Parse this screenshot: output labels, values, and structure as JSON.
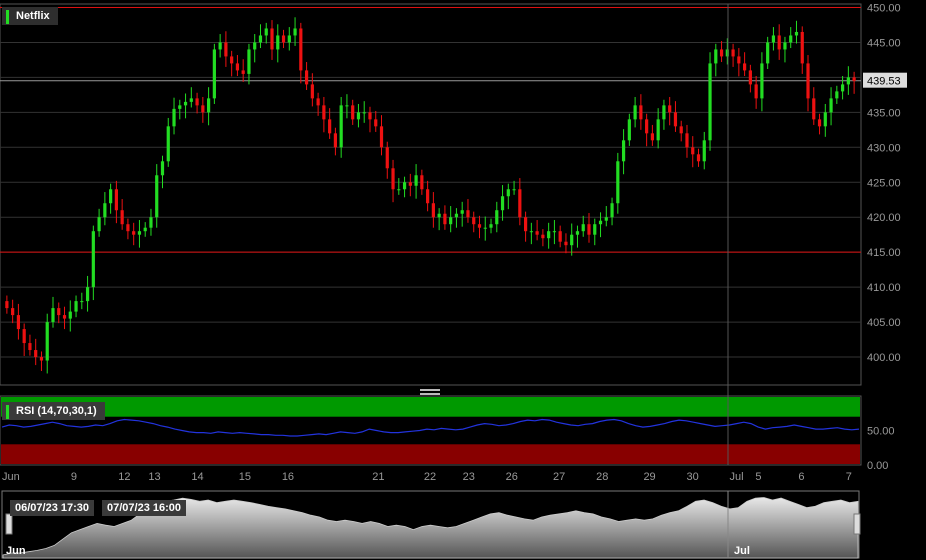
{
  "window": {
    "symbol": "Netflix"
  },
  "colors": {
    "up": "#22dd22",
    "down": "#ee1111",
    "rsi_line": "#2233dd",
    "upper_band": "#009900",
    "lower_band": "#880000",
    "hline": "#dd1111"
  },
  "chart_data": [
    {
      "type": "candlestick",
      "title": "Netflix",
      "ylim": [
        396,
        450.5
      ],
      "y_ticks": [
        "450.00",
        "445.00",
        "440.00",
        "435.00",
        "430.00",
        "425.00",
        "420.00",
        "415.00",
        "410.00",
        "405.00",
        "400.00"
      ],
      "y_tick_values": [
        450,
        445,
        440,
        435,
        430,
        425,
        420,
        415,
        410,
        405,
        400
      ],
      "last_price": 439.53,
      "last_price_label": "439.53",
      "horizontal_lines": [
        450,
        415
      ],
      "grid": true,
      "closes": [
        407,
        406,
        404,
        402,
        401,
        400,
        399.5,
        405,
        407,
        406,
        405.5,
        406.5,
        408,
        408,
        410,
        418,
        420,
        422,
        424,
        421,
        419,
        418,
        417.5,
        418,
        418.5,
        420,
        426,
        428,
        433,
        435.5,
        436,
        436.5,
        437,
        436,
        435,
        437,
        444,
        445,
        443,
        442,
        441,
        440.5,
        444,
        445,
        446,
        447,
        444,
        446,
        445,
        446,
        447,
        441,
        439,
        437,
        436,
        434,
        432,
        430,
        436,
        436,
        434,
        435,
        435,
        434,
        433,
        430,
        427,
        424,
        424,
        425,
        424.5,
        426,
        424,
        422,
        420,
        420.5,
        419,
        420,
        420.5,
        421,
        420,
        419,
        418.5,
        418.5,
        419,
        421,
        423,
        424,
        424,
        420,
        418,
        418,
        417.5,
        417,
        418,
        418,
        416.5,
        416,
        417.5,
        418,
        419,
        417.5,
        419,
        419.5,
        420,
        422,
        428,
        431,
        434,
        436,
        434,
        432,
        431,
        434,
        436,
        435,
        433,
        432,
        430,
        429,
        428,
        431,
        442,
        444,
        443,
        444,
        443,
        442,
        441,
        439,
        437,
        442,
        445,
        446,
        444,
        445,
        446,
        446.5,
        442,
        437,
        434,
        433,
        435,
        437,
        438,
        439,
        440,
        439.5
      ],
      "x_ticks": [
        "Jun",
        "9",
        "12",
        "13",
        "14",
        "15",
        "16",
        "21",
        "22",
        "23",
        "26",
        "27",
        "28",
        "29",
        "30",
        "Jul",
        "5",
        "6",
        "7"
      ],
      "x_tick_positions": [
        0.0,
        0.08,
        0.135,
        0.17,
        0.22,
        0.275,
        0.325,
        0.43,
        0.49,
        0.535,
        0.585,
        0.64,
        0.69,
        0.745,
        0.795,
        0.845,
        0.875,
        0.925,
        0.98
      ]
    },
    {
      "type": "line",
      "title": "RSI (14,70,30,1)",
      "ylim": [
        0,
        100
      ],
      "y_ticks": [
        "50.00",
        "0.00"
      ],
      "y_tick_values": [
        50,
        0
      ],
      "upper_band": 70,
      "lower_band": 30,
      "values": [
        55,
        58,
        57,
        55,
        56,
        58,
        60,
        62,
        60,
        57,
        56,
        55,
        56,
        58,
        57,
        60,
        64,
        66,
        65,
        64,
        62,
        60,
        57,
        55,
        52,
        50,
        48,
        47,
        47,
        46,
        48,
        47,
        46,
        47,
        46,
        45,
        44,
        44,
        43,
        43,
        42,
        42,
        43,
        44,
        45,
        44,
        46,
        48,
        47,
        46,
        48,
        52,
        50,
        48,
        47,
        47,
        48,
        49,
        50,
        52,
        51,
        53,
        52,
        51,
        52,
        55,
        58,
        60,
        59,
        57,
        58,
        60,
        63,
        65,
        64,
        66,
        65,
        62,
        60,
        58,
        57,
        59,
        60,
        63,
        65,
        66,
        64,
        60,
        57,
        55,
        56,
        58,
        60,
        63,
        65,
        64,
        62,
        60,
        58,
        56,
        57,
        58,
        60,
        62,
        60,
        55,
        52,
        54,
        55,
        56,
        58,
        56,
        54,
        52,
        52,
        53,
        54,
        52,
        51,
        52
      ]
    },
    {
      "type": "area",
      "role": "navigator",
      "start_label": "06/07/23 17:30",
      "end_label": "07/07/23 16:00",
      "month_labels": [
        "Jun",
        "Jul"
      ],
      "values": [
        0.05,
        0.08,
        0.08,
        0.1,
        0.12,
        0.15,
        0.2,
        0.3,
        0.4,
        0.45,
        0.5,
        0.55,
        0.52,
        0.5,
        0.55,
        0.6,
        0.7,
        0.8,
        0.85,
        0.9,
        0.92,
        0.95,
        0.93,
        0.9,
        0.92,
        0.88,
        0.9,
        0.92,
        0.9,
        0.88,
        0.85,
        0.82,
        0.8,
        0.78,
        0.75,
        0.72,
        0.68,
        0.65,
        0.6,
        0.58,
        0.6,
        0.58,
        0.55,
        0.58,
        0.55,
        0.5,
        0.52,
        0.5,
        0.45,
        0.5,
        0.52,
        0.5,
        0.48,
        0.5,
        0.55,
        0.6,
        0.65,
        0.7,
        0.72,
        0.68,
        0.65,
        0.62,
        0.6,
        0.65,
        0.68,
        0.7,
        0.72,
        0.75,
        0.72,
        0.7,
        0.65,
        0.62,
        0.58,
        0.6,
        0.62,
        0.6,
        0.62,
        0.68,
        0.72,
        0.75,
        0.82,
        0.9,
        0.92,
        0.88,
        0.82,
        0.78,
        0.8,
        0.9,
        0.95,
        0.96,
        0.92,
        0.95,
        0.9,
        0.85,
        0.8,
        0.82,
        0.88,
        0.9,
        0.92,
        0.88,
        0.9
      ]
    }
  ]
}
